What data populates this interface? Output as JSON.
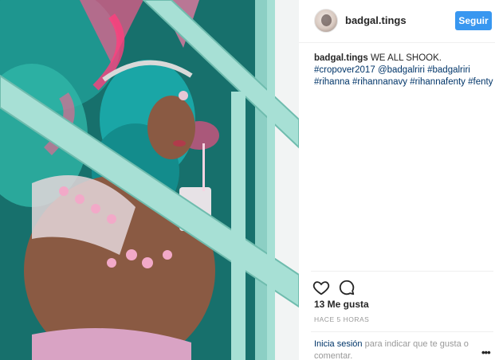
{
  "post": {
    "photo_alt": "Photo",
    "header": {
      "username": "badgal.tings",
      "follow_label": "Seguir"
    },
    "caption": {
      "username": "badgal.tings",
      "text": "WE ALL SHOOK.",
      "tags": [
        "#cropover2017",
        "@badgalriri",
        "#badgalriri",
        "#rihanna",
        "#rihannanavy",
        "#rihannafenty",
        "#fenty"
      ]
    },
    "actions": {
      "like_icon": "heart-icon",
      "comment_icon": "comment-icon"
    },
    "likes_text": "13 Me gusta",
    "time_text": "HACE 5 HORAS",
    "login": {
      "link_text": "Inicia sesión",
      "rest_text": " para indicar que te gusta o comentar.",
      "more_icon": "more-options-icon"
    }
  }
}
